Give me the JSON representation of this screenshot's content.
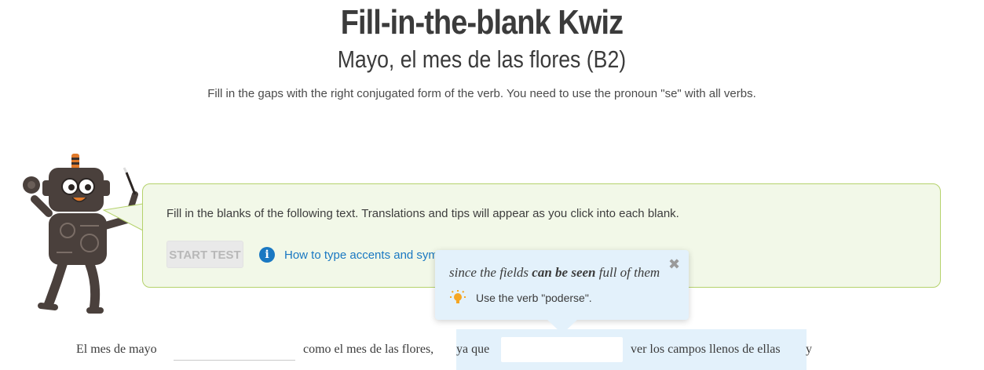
{
  "header": {
    "title": "Fill-in-the-blank Kwiz",
    "subtitle": "Mayo, el mes de las flores (B2)",
    "instructions": "Fill in the gaps with the right conjugated form of the verb. You need to use the pronoun \"se\" with all verbs."
  },
  "mascot": {
    "icon": "robot-mascot-icon"
  },
  "intro_bubble": {
    "text": "Fill in the blanks of the following text. Translations and tips will appear as you click into each blank.",
    "start_button_label": "START TEST",
    "start_button_state": "disabled",
    "help_link_label": "How to type accents and symbols",
    "help_icon": "info-icon"
  },
  "tooltip": {
    "translation_before": "since the fields",
    "translation_bold": "can be seen",
    "translation_after": "full of them",
    "close_icon": "close-icon",
    "tip_icon": "lightbulb-icon",
    "tip_text": "Use the verb \"poderse\"."
  },
  "exercise": {
    "segments": [
      {
        "text": "El mes de mayo",
        "blank_after": true,
        "blank_value": ""
      },
      {
        "text": "como el mes de las flores,",
        "blank_after": false
      },
      {
        "text": "ya que",
        "blank_after": true,
        "blank_value": "",
        "active": true
      },
      {
        "text": "ver los campos llenos de ellas",
        "blank_after": false
      },
      {
        "text": "y",
        "blank_after": false
      }
    ]
  },
  "colors": {
    "title": "#3b3b3b",
    "bubble_bg": "#f2f8e8",
    "bubble_border": "#b5d26c",
    "link": "#1a78c2",
    "tooltip_bg": "#e3f1fb",
    "bulb": "#f5a623"
  }
}
